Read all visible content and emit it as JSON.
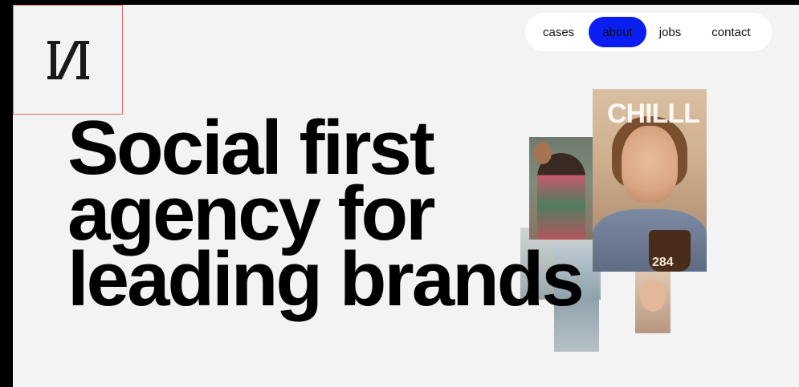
{
  "logo": {
    "icon": "agency-logo-mark"
  },
  "nav": {
    "items": [
      {
        "label": "cases"
      },
      {
        "label": "about"
      },
      {
        "label": "jobs"
      },
      {
        "label": "contact"
      }
    ],
    "active_index": 1,
    "active_color": "#0a1ef0"
  },
  "hero": {
    "line1": "Social first",
    "line2": "agency for",
    "line3": "leading brands"
  },
  "collage": {
    "main_photo_brand_text": "CHILLL",
    "main_photo_cup_text": "284"
  },
  "colors": {
    "background": "#f3f3f3",
    "frame": "#000000",
    "logo_box_border": "#e06a6a"
  }
}
